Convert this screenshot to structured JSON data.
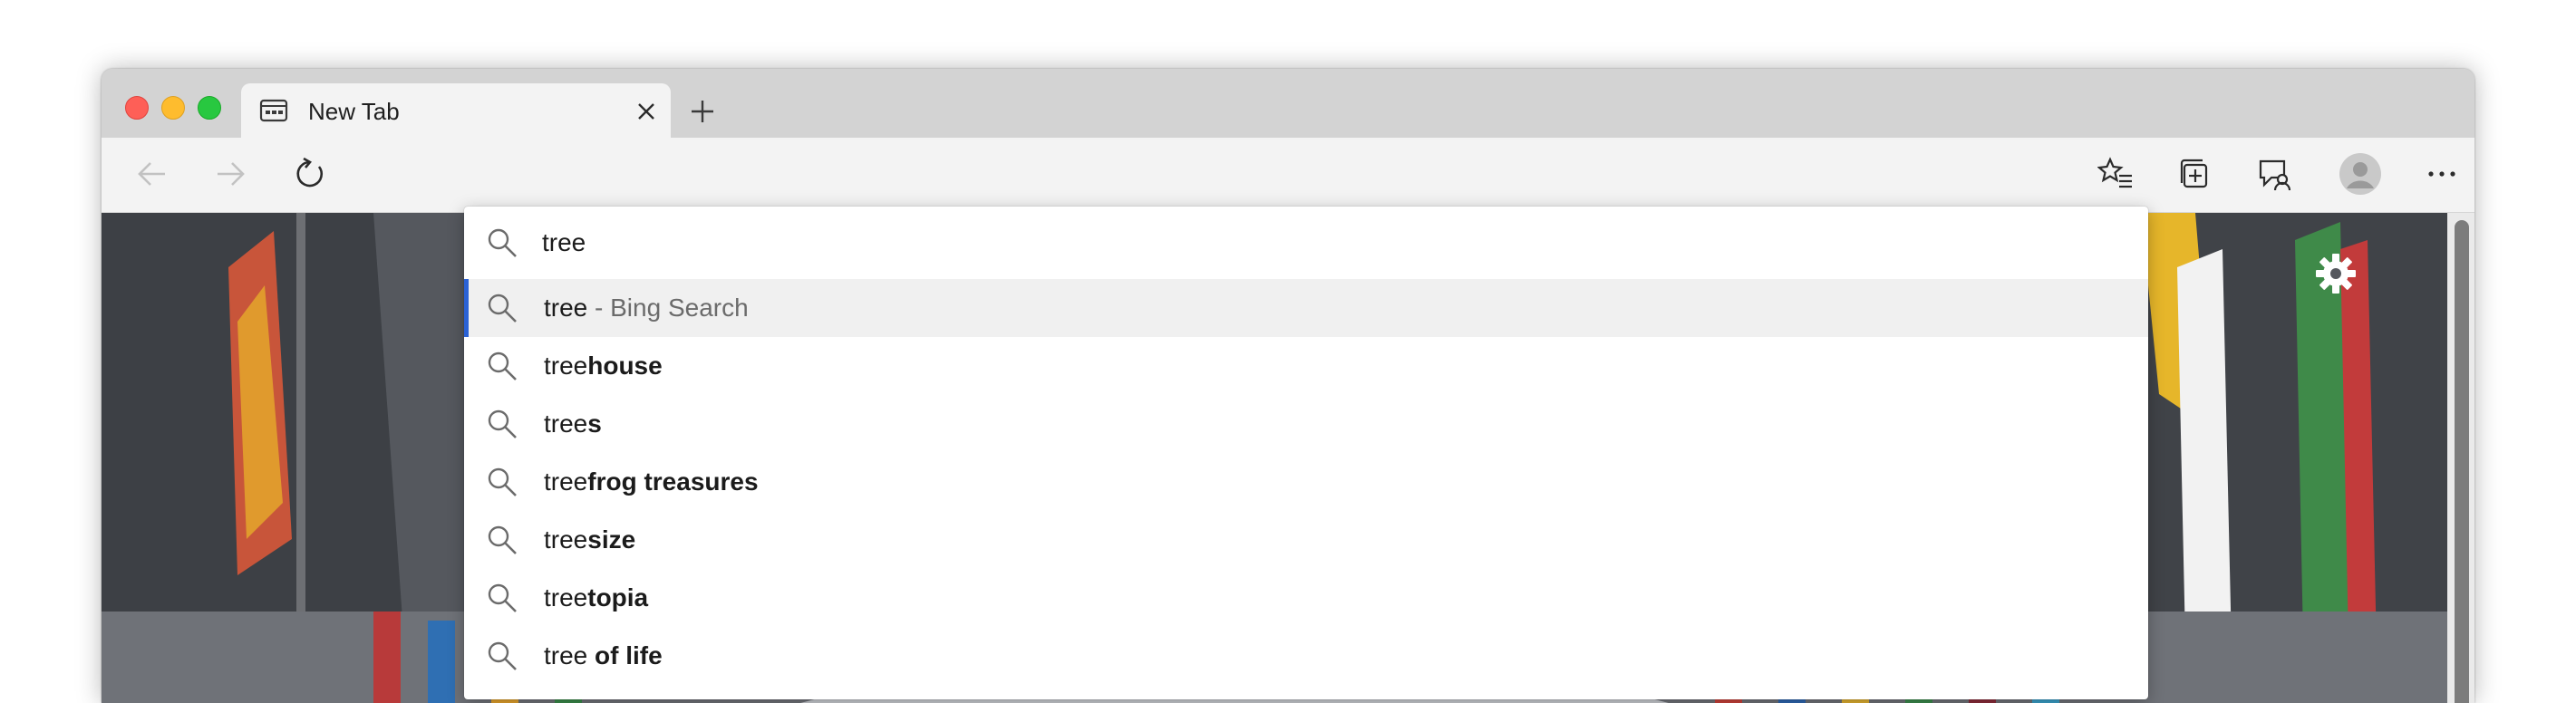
{
  "window": {
    "traffic_lights": [
      "close",
      "minimize",
      "zoom"
    ]
  },
  "tab": {
    "title": "New Tab",
    "favicon": "newtab-page-icon"
  },
  "toolbar": {
    "nav_icons": [
      "back-arrow-icon",
      "forward-arrow-icon",
      "refresh-icon"
    ],
    "right_icons": [
      "favorites-icon",
      "collections-icon",
      "feedback-icon",
      "profile-avatar",
      "more-menu-icon"
    ]
  },
  "omnibox": {
    "query": "tree",
    "suggestions": [
      {
        "typed": "tree",
        "completion": "",
        "suffix": "- Bing Search",
        "selected": true
      },
      {
        "typed": "tree",
        "completion": "house",
        "suffix": "",
        "selected": false
      },
      {
        "typed": "tree",
        "completion": "s",
        "suffix": "",
        "selected": false
      },
      {
        "typed": "tree",
        "completion": "frog treasures",
        "suffix": "",
        "selected": false
      },
      {
        "typed": "tree",
        "completion": "size",
        "suffix": "",
        "selected": false
      },
      {
        "typed": "tree",
        "completion": "topia",
        "suffix": "",
        "selected": false
      },
      {
        "typed": "tree",
        "completion": " of life",
        "suffix": "",
        "selected": false
      }
    ]
  },
  "content": {
    "settings_icon": "gear-icon"
  },
  "colors": {
    "selected_accent": "#2a62d6",
    "close": "#fe5f57",
    "minimize": "#febc2e",
    "zoom": "#28c840"
  }
}
